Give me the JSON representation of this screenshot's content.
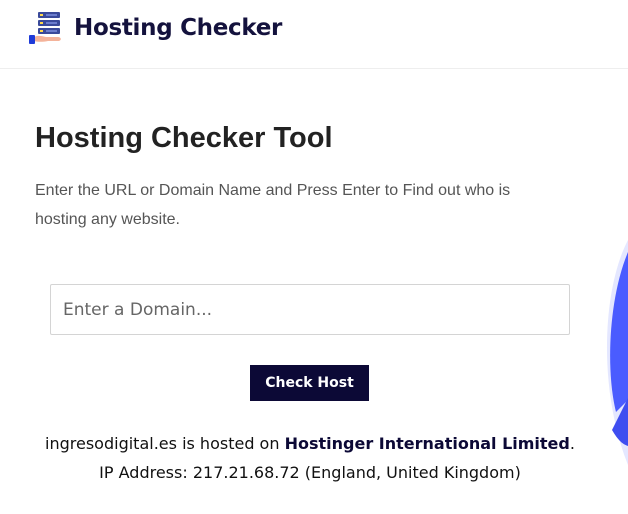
{
  "header": {
    "site_title": "Hosting Checker",
    "logo_icon": "server-rack-hand-icon"
  },
  "main": {
    "title": "Hosting Checker Tool",
    "description": "Enter the URL or Domain Name and Press Enter to Find out who is hosting any website.",
    "domain_input": {
      "placeholder": "Enter a Domain...",
      "value": ""
    },
    "check_button_label": "Check Host"
  },
  "result": {
    "domain": "ingresodigital.es",
    "hosted_on_text": "is hosted on",
    "host": "Hostinger International Limited",
    "host_suffix": ".",
    "ip_label": "IP Address:",
    "ip": "217.21.68.72",
    "location": "(England, United Kingdom)"
  },
  "colors": {
    "brand_navy": "#0c0936",
    "accent_blue": "#4a5cff",
    "accent_light": "#e4e7ff"
  }
}
